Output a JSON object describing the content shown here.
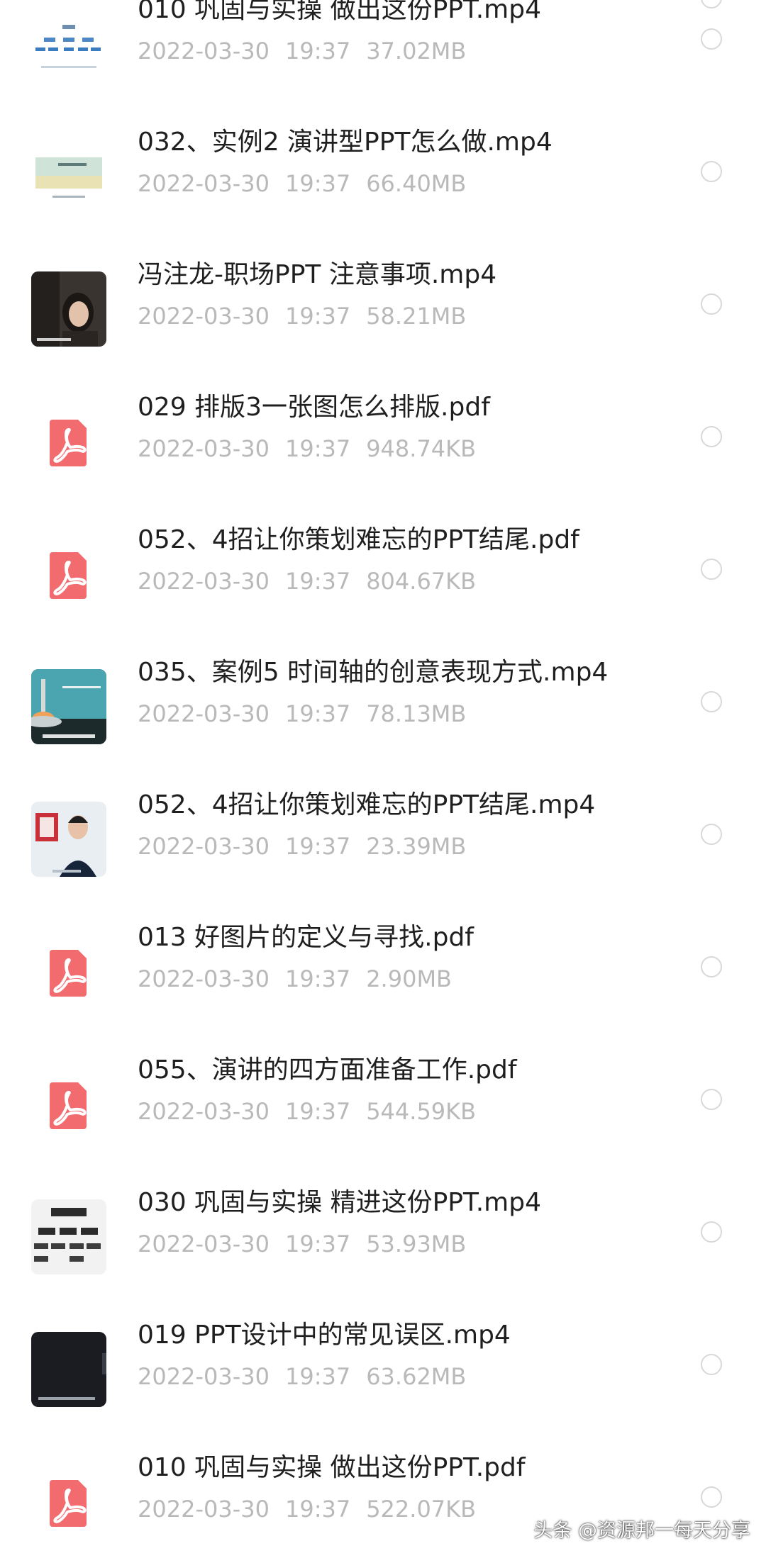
{
  "files": [
    {
      "name": "010 巩固与实操 做出这份PPT.mp4",
      "date": "2022-03-30",
      "time": "19:37",
      "size": "37.02MB",
      "thumb": "video-thumb-diagram"
    },
    {
      "name": "032、实例2 演讲型PPT怎么做.mp4",
      "date": "2022-03-30",
      "time": "19:37",
      "size": "66.40MB",
      "thumb": "video-thumb-slide"
    },
    {
      "name": "冯注龙-职场PPT 注意事项.mp4",
      "date": "2022-03-30",
      "time": "19:37",
      "size": "58.21MB",
      "thumb": "video-thumb-presenter"
    },
    {
      "name": "029 排版3一张图怎么排版.pdf",
      "date": "2022-03-30",
      "time": "19:37",
      "size": "948.74KB",
      "thumb": "pdf-icon"
    },
    {
      "name": "052、4招让你策划难忘的PPT结尾.pdf",
      "date": "2022-03-30",
      "time": "19:37",
      "size": "804.67KB",
      "thumb": "pdf-icon"
    },
    {
      "name": "035、案例5 时间轴的创意表现方式.mp4",
      "date": "2022-03-30",
      "time": "19:37",
      "size": "78.13MB",
      "thumb": "video-thumb-rocket"
    },
    {
      "name": "052、4招让你策划难忘的PPT结尾.mp4",
      "date": "2022-03-30",
      "time": "19:37",
      "size": "23.39MB",
      "thumb": "video-thumb-host"
    },
    {
      "name": "013 好图片的定义与寻找.pdf",
      "date": "2022-03-30",
      "time": "19:37",
      "size": "2.90MB",
      "thumb": "pdf-icon"
    },
    {
      "name": "055、演讲的四方面准备工作.pdf",
      "date": "2022-03-30",
      "time": "19:37",
      "size": "544.59KB",
      "thumb": "pdf-icon"
    },
    {
      "name": "030 巩固与实操 精进这份PPT.mp4",
      "date": "2022-03-30",
      "time": "19:37",
      "size": "53.93MB",
      "thumb": "video-thumb-chart"
    },
    {
      "name": "019 PPT设计中的常见误区.mp4",
      "date": "2022-03-30",
      "time": "19:37",
      "size": "63.62MB",
      "thumb": "video-thumb-dark"
    },
    {
      "name": "010 巩固与实操 做出这份PPT.pdf",
      "date": "2022-03-30",
      "time": "19:37",
      "size": "522.07KB",
      "thumb": "pdf-icon"
    }
  ],
  "watermark": "头条 @资源邦一每天分享",
  "colors": {
    "pdf_red": "#f26b6f",
    "title": "#1f1f1f",
    "meta": "#b9b9b9"
  }
}
